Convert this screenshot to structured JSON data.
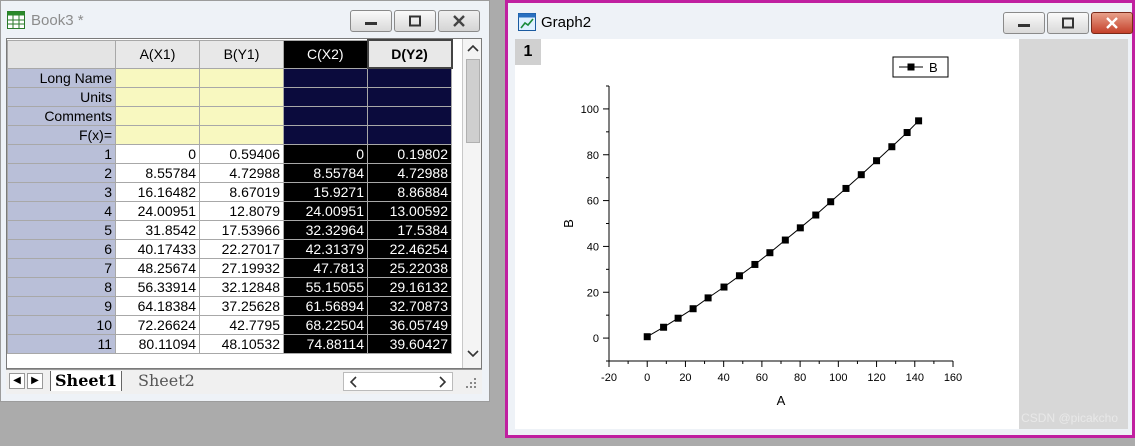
{
  "book": {
    "title": "Book3 *",
    "columns": [
      "A(X1)",
      "B(Y1)",
      "C(X2)",
      "D(Y2)"
    ],
    "meta_rows": [
      "Long Name",
      "Units",
      "Comments",
      "F(x)="
    ],
    "rows": [
      [
        "1",
        "0",
        "0.59406",
        "0",
        "0.19802"
      ],
      [
        "2",
        "8.55784",
        "4.72988",
        "8.55784",
        "4.72988"
      ],
      [
        "3",
        "16.16482",
        "8.67019",
        "15.9271",
        "8.86884"
      ],
      [
        "4",
        "24.00951",
        "12.8079",
        "24.00951",
        "13.00592"
      ],
      [
        "5",
        "31.8542",
        "17.53966",
        "32.32964",
        "17.5384"
      ],
      [
        "6",
        "40.17433",
        "22.27017",
        "42.31379",
        "22.46254"
      ],
      [
        "7",
        "48.25674",
        "27.19932",
        "47.7813",
        "25.22038"
      ],
      [
        "8",
        "56.33914",
        "32.12848",
        "55.15055",
        "29.16132"
      ],
      [
        "9",
        "64.18384",
        "37.25628",
        "61.56894",
        "32.70873"
      ],
      [
        "10",
        "72.26624",
        "42.7795",
        "68.22504",
        "36.05749"
      ],
      [
        "11",
        "80.11094",
        "48.10532",
        "74.88114",
        "39.60427"
      ]
    ],
    "tabs": [
      "Sheet1",
      "Sheet2"
    ]
  },
  "graph": {
    "title": "Graph2",
    "layer": "1",
    "watermark": "CSDN @picakcho"
  },
  "chart_data": {
    "type": "line",
    "xlabel": "A",
    "ylabel": "B",
    "xlim": [
      -20,
      160
    ],
    "ylim": [
      -10,
      110
    ],
    "xticks": [
      "-20",
      "0",
      "20",
      "40",
      "60",
      "80",
      "100",
      "120",
      "140",
      "160"
    ],
    "yticks": [
      "0",
      "20",
      "40",
      "60",
      "80",
      "100"
    ],
    "series": [
      {
        "name": "B",
        "marker": "square",
        "x": [
          0,
          8.55784,
          16.16482,
          24.00951,
          31.8542,
          40.17433,
          48.25674,
          56.33914,
          64.18384,
          72.26624,
          80.11094,
          88.2,
          96.0,
          104.0,
          112.0,
          120.0,
          128.0,
          136.0,
          142.0
        ],
        "y": [
          0.59406,
          4.72988,
          8.67019,
          12.8079,
          17.53966,
          22.27017,
          27.19932,
          32.12848,
          37.25628,
          42.7795,
          48.10532,
          53.7,
          59.5,
          65.3,
          71.3,
          77.4,
          83.5,
          89.7,
          94.8
        ]
      }
    ]
  }
}
